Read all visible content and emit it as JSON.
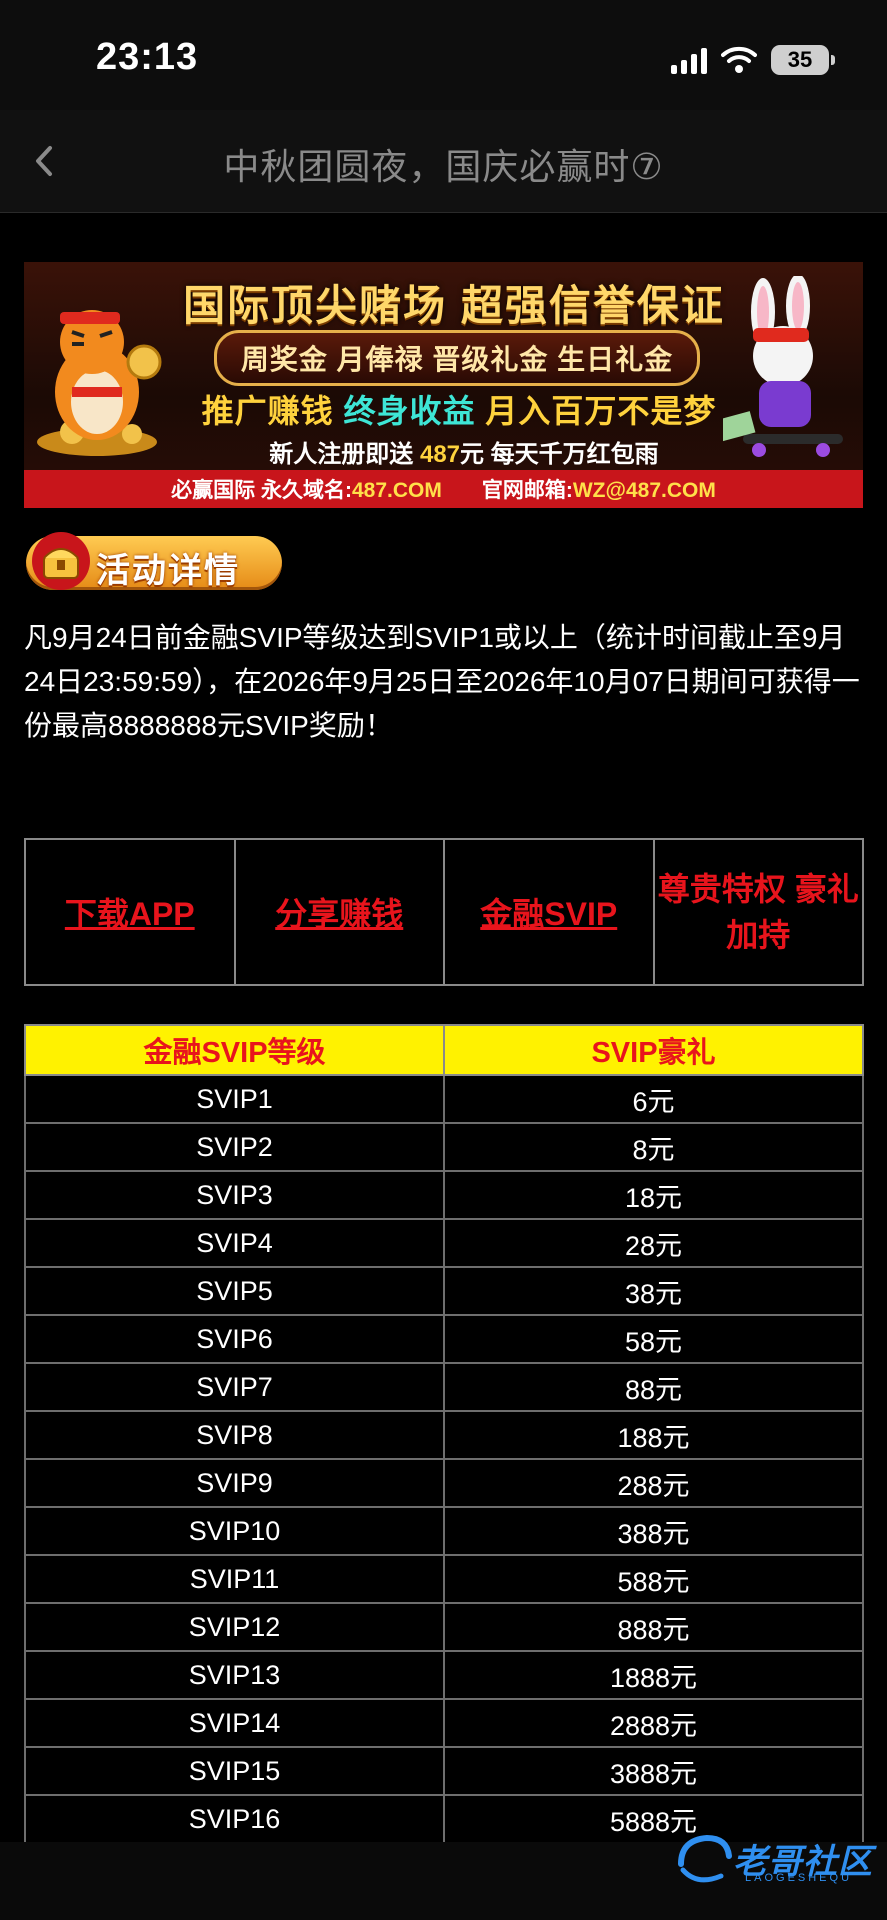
{
  "status_bar": {
    "time": "23:13",
    "battery": "35"
  },
  "nav": {
    "title": "中秋团圆夜，国庆必赢时⑦"
  },
  "banner": {
    "headline": "国际顶尖赌场 超强信誉保证",
    "benefits": "周奖金 月俸禄 晋级礼金 生日礼金",
    "slogan_a": "推广赚钱",
    "slogan_b": "终身收益",
    "slogan_c": "月入百万不是梦",
    "promo_prefix": "新人注册即送",
    "promo_amount": "487",
    "promo_suffix": "元 每天千万红包雨",
    "footer_label_1": "必赢国际 永久域名:",
    "footer_value_1": "487.COM",
    "footer_label_2": "官网邮箱:",
    "footer_value_2": "WZ@487.COM"
  },
  "section": {
    "badge": "活动详情"
  },
  "description": "凡9月24日前金融SVIP等级达到SVIP1或以上（统计时间截止至9月24日23:59:59），在2026年9月25日至2026年10月07日期间可获得一份最高8888888元SVIP奖励！",
  "links": {
    "download": "下载APP",
    "share": "分享赚钱",
    "finance": "金融SVIP",
    "privilege": "尊贵特权 豪礼加持"
  },
  "vip_table": {
    "headers": [
      "金融SVIP等级",
      "SVIP豪礼"
    ],
    "rows": [
      [
        "SVIP1",
        "6元"
      ],
      [
        "SVIP2",
        "8元"
      ],
      [
        "SVIP3",
        "18元"
      ],
      [
        "SVIP4",
        "28元"
      ],
      [
        "SVIP5",
        "38元"
      ],
      [
        "SVIP6",
        "58元"
      ],
      [
        "SVIP7",
        "88元"
      ],
      [
        "SVIP8",
        "188元"
      ],
      [
        "SVIP9",
        "288元"
      ],
      [
        "SVIP10",
        "388元"
      ],
      [
        "SVIP11",
        "588元"
      ],
      [
        "SVIP12",
        "888元"
      ],
      [
        "SVIP13",
        "1888元"
      ],
      [
        "SVIP14",
        "2888元"
      ],
      [
        "SVIP15",
        "3888元"
      ],
      [
        "SVIP16",
        "5888元"
      ]
    ]
  },
  "watermark": {
    "text": "老哥社区",
    "sub": "LAOGESHEQU"
  },
  "colors": {
    "background": "#000000",
    "link_red": "#e8141c",
    "header_yellow": "#fff200",
    "banner_footer_red": "#c8151b"
  }
}
